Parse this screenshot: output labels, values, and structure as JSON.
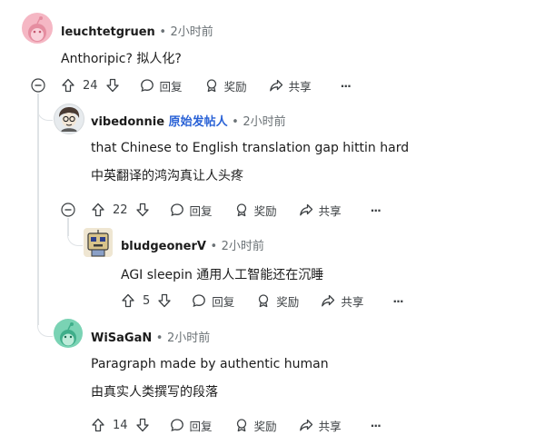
{
  "comments": [
    {
      "user": "leuchtetgruen",
      "op_badge": "",
      "time": "2小时前",
      "lines": [
        "Anthoripic?  拟人化?"
      ],
      "votes": "24",
      "reply": "回复",
      "award": "奖励",
      "share": "共享",
      "more": "···"
    },
    {
      "user": "vibedonnie",
      "op_badge": "原始发帖人",
      "time": "2小时前",
      "lines": [
        "that Chinese to English translation gap hittin hard",
        "中英翻译的鸿沟真让人头疼"
      ],
      "votes": "22",
      "reply": "回复",
      "award": "奖励",
      "share": "共享",
      "more": "···"
    },
    {
      "user": "bludgeonerV",
      "op_badge": "",
      "time": "2小时前",
      "lines": [
        "AGI sleepin   通用人工智能还在沉睡"
      ],
      "votes": "5",
      "reply": "回复",
      "award": "奖励",
      "share": "共享",
      "more": "···"
    },
    {
      "user": "WiSaGaN",
      "op_badge": "",
      "time": "2小时前",
      "lines": [
        "Paragraph made by authentic human",
        "由真实人类撰写的段落"
      ],
      "votes": "14",
      "reply": "回复",
      "award": "奖励",
      "share": "共享",
      "more": "···"
    }
  ],
  "separator": "•",
  "colors": {
    "op_badge": "#2a62d6",
    "thread_line": "#dfe3e6",
    "meta": "#6b7276"
  },
  "icons": [
    "upvote-icon",
    "downvote-icon",
    "comment-icon",
    "award-icon",
    "share-icon",
    "more-icon",
    "collapse-icon",
    "snoo-avatar-icon"
  ]
}
